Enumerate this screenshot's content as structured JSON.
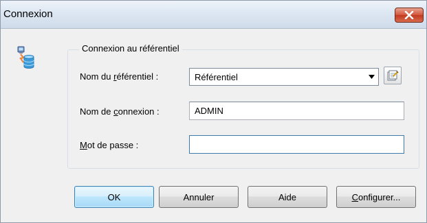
{
  "window": {
    "title": "Connexion",
    "close_icon": "close-icon"
  },
  "icons": {
    "app": "database-connection-icon",
    "browse": "browse-repository-icon",
    "dropdown": "chevron-down-icon"
  },
  "group": {
    "legend": "Connexion au référentiel"
  },
  "form": {
    "repository": {
      "label_pre": "Nom du ",
      "label_accel": "r",
      "label_post": "éférentiel :",
      "value": "Référentiel"
    },
    "login": {
      "label_pre": "Nom de ",
      "label_accel": "c",
      "label_post": "onnexion :",
      "value": "ADMIN"
    },
    "password": {
      "label_pre": "",
      "label_accel": "M",
      "label_post": "ot de passe :",
      "value": ""
    }
  },
  "buttons": {
    "ok": "OK",
    "cancel": "Annuler",
    "help": "Aide",
    "configure_accel": "C",
    "configure_rest": "onfigurer..."
  },
  "colors": {
    "close_button": "#d2543a",
    "default_button_border": "#3c7fb1",
    "focus_border": "#3d7bad"
  }
}
